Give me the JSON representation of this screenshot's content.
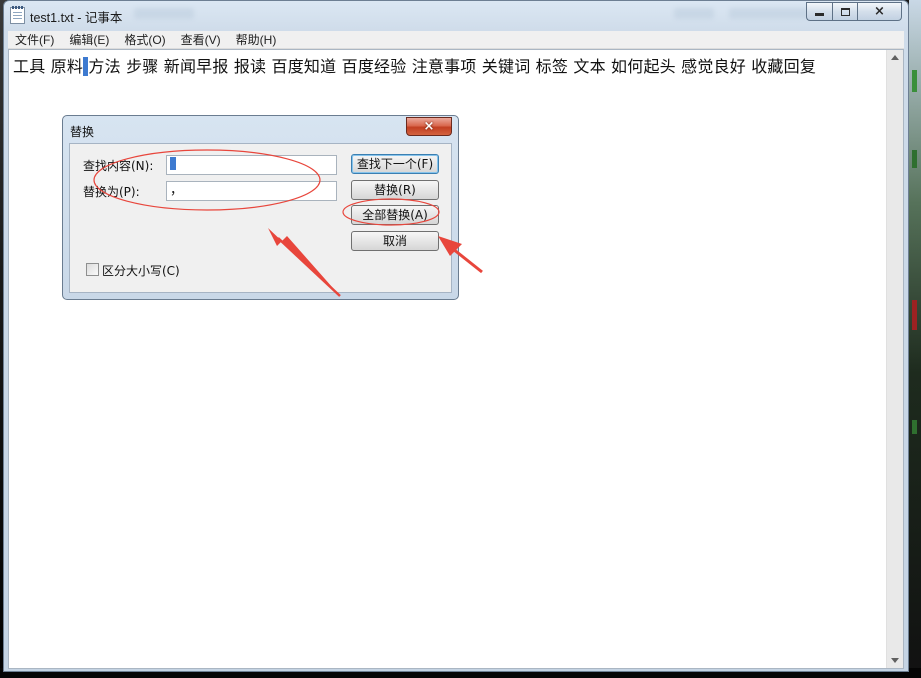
{
  "window": {
    "title": "test1.txt - 记事本",
    "buttons": {
      "minimize": "minimize",
      "maximize": "maximize",
      "close": "×"
    }
  },
  "menu": [
    {
      "label": "文件(F)"
    },
    {
      "label": "编辑(E)"
    },
    {
      "label": "格式(O)"
    },
    {
      "label": "查看(V)"
    },
    {
      "label": "帮助(H)"
    }
  ],
  "editor": {
    "text_before": "工具 原料",
    "text_selected": " ",
    "text_after": "方法 步骤 新闻早报 报读 百度知道 百度经验 注意事项 关键词 标签 文本 如何起头 感觉良好 收藏回复"
  },
  "dialog": {
    "title": "替换",
    "close": "×",
    "find_label": "查找内容(N):",
    "find_value": "",
    "replace_label": "替换为(P):",
    "replace_value": "，",
    "case_label": "区分大小写(C)",
    "case_checked": false,
    "buttons": {
      "find_next": "查找下一个(F)",
      "replace": "替换(R)",
      "replace_all": "全部替换(A)",
      "cancel": "取消"
    }
  },
  "colors": {
    "annotation": "#e8463c",
    "selection": "#3d7ad0",
    "dialog_close": "#c8472c"
  },
  "icons": {
    "app": "notepad-icon",
    "dialog_close": "close-icon"
  }
}
